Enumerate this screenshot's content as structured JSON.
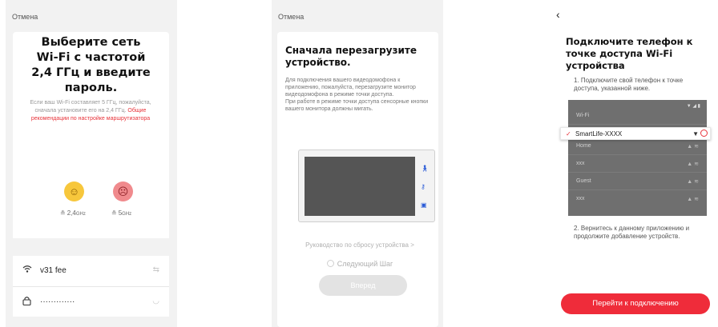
{
  "screen1": {
    "cancel": "Отмена",
    "title_lines": [
      "Выберите сеть",
      "Wi-Fi с частотой",
      "2,4 ГГц и введите",
      "пароль."
    ],
    "note_plain": "Если ваш Wi-Fi составляет 5 ГГц, пожалуйста, сначала установите его на 2,4 ГГц.",
    "note_link": "Общие рекомендации по настройке маршрутизатора",
    "band_24": "2,4",
    "band_24_unit": "GHz",
    "band_5": "5",
    "band_5_unit": "GHz",
    "wifi_name": "v31 fee",
    "password_mask": "·············"
  },
  "screen2": {
    "cancel": "Отмена",
    "title": "Сначала перезагрузите устройство.",
    "body_p1": "Для подключения вашего видеодомофона к приложению, пожалуйста, перезагрузите монитор видеодомофона в режиме точки доступа.",
    "body_p2": "При работе в режиме точки доступа сенсорные кнопки вашего монитора должны мигать.",
    "reset_guide": "Руководство по сбросу устройства >",
    "next_step": "Следующий Шаг",
    "button": "Вперед"
  },
  "screen3": {
    "title": "Подключите телефон к точке доступа Wi-Fi устройства",
    "step1": "1. Подключите свой телефон к точке доступа, указанной ниже.",
    "wifi_header": "Wi-Fi",
    "selected_network": "SmartLife-XXXX",
    "networks": [
      "Home",
      "xxx",
      "Guest",
      "xxx"
    ],
    "step2": "2. Вернитесь к данному приложению и продолжите добавление устройств.",
    "button": "Перейти к подключению"
  },
  "colors": {
    "accent": "#ef2c3a",
    "background": "#f2f2f2",
    "monitor_blue": "#2a5bd7"
  }
}
